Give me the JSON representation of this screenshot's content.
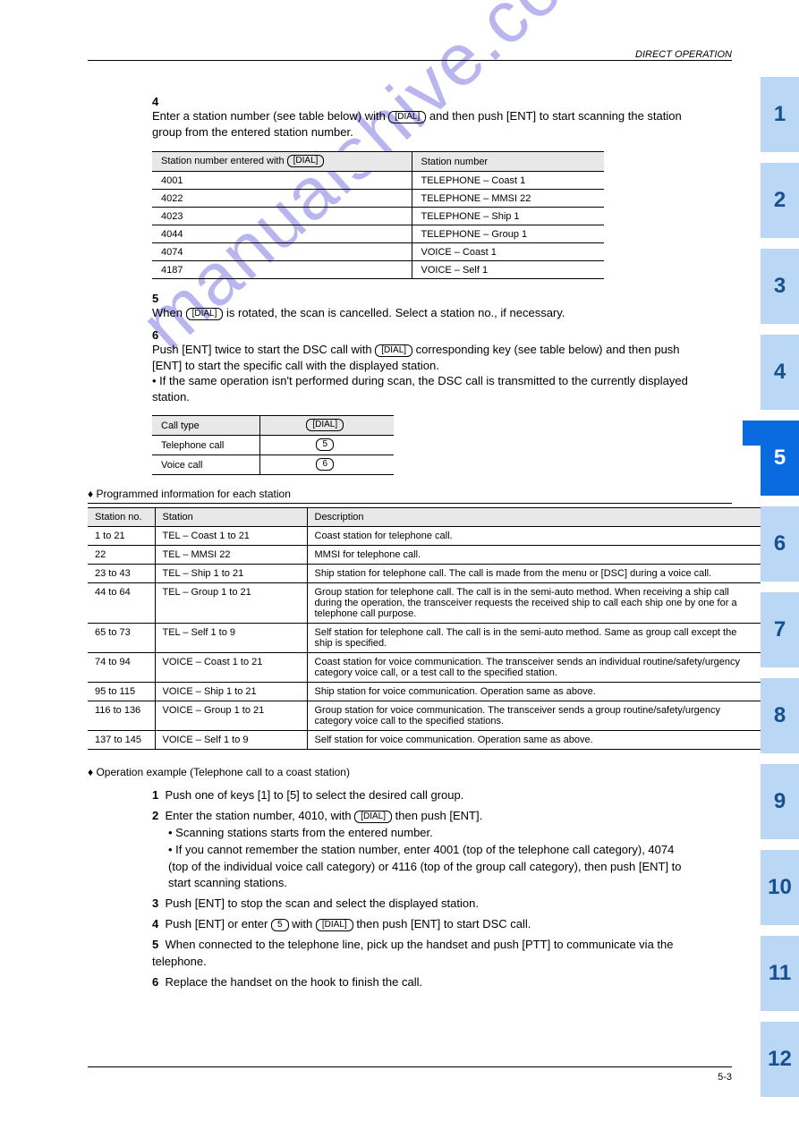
{
  "header": {
    "section_title": "DIRECT OPERATION"
  },
  "watermark": "manualshive.com",
  "steps": {
    "s4": {
      "num": "4",
      "text_prefix": "Enter a station number (see table below) with ",
      "key": "[DIAL]",
      "text_suffix": " and then push [ENT] to start scanning the station group from the entered station number."
    },
    "table1_headers": [
      "Station number entered with ",
      "Station number"
    ],
    "table1_key": "[DIAL]",
    "table1_rows": [
      [
        "4001",
        "TELEPHONE – Coast 1"
      ],
      [
        "4022",
        "TELEPHONE – MMSI 22"
      ],
      [
        "4023",
        "TELEPHONE – Ship 1"
      ],
      [
        "4044",
        "TELEPHONE – Group 1"
      ],
      [
        "4074",
        "VOICE – Coast 1"
      ],
      [
        "4187",
        "VOICE – Self 1"
      ]
    ],
    "s5": {
      "num": "5",
      "text_prefix": "When ",
      "key": "[DIAL]",
      "text_suffix": " is rotated, the scan is cancelled. Select a station no., if necessary."
    },
    "s6": {
      "num": "6",
      "text_prefix": "Push [ENT] twice to start the DSC call with ",
      "key": "[DIAL]",
      "text_mid": " corresponding key (see table below) and then push [ENT] to start the specific call with the displayed station.",
      "text_line2": "• If the same operation isn't performed during scan, the DSC call is transmitted to the currently displayed station."
    },
    "table2_headers": [
      "Call type",
      ""
    ],
    "table2_key": "[DIAL]",
    "table2_rows": [
      [
        "Telephone call",
        "5"
      ],
      [
        "Voice call",
        "6"
      ]
    ]
  },
  "main_table": {
    "heading": "♦ Programmed information for each station",
    "headers": [
      "Station no.",
      "Station",
      "Description"
    ],
    "rows": [
      [
        "1 to 21",
        "TEL – Coast 1 to 21",
        "Coast station for telephone call."
      ],
      [
        "22",
        "TEL – MMSI 22",
        "MMSI for telephone call."
      ],
      [
        "23 to 43",
        "TEL – Ship 1 to 21",
        "Ship station for telephone call. The call is made from the menu or [DSC] during a voice call."
      ],
      [
        "44 to 64",
        "TEL – Group 1 to 21",
        "Group station for telephone call. The call is in the semi-auto method. When receiving a ship call during the operation, the transceiver requests the received ship to call each ship one by one for a telephone call purpose."
      ],
      [
        "65 to 73",
        "TEL – Self 1 to 9",
        "Self station for telephone call. The call is in the semi-auto method. Same as group call except the ship is specified."
      ],
      [
        "74 to 94",
        "VOICE – Coast 1 to 21",
        "Coast station for voice communication. The transceiver sends an individual routine/safety/urgency category voice call, or a test call to the specified station."
      ],
      [
        "95 to 115",
        "VOICE – Ship 1 to 21",
        "Ship station for voice communication. Operation same as above."
      ],
      [
        "116 to 136",
        "VOICE – Group 1 to 21",
        "Group station for voice communication. The transceiver sends a group routine/safety/urgency category voice call to the specified stations."
      ],
      [
        "137 to 145",
        "VOICE – Self 1 to 9",
        "Self station for voice communication. Operation same as above."
      ]
    ]
  },
  "example": {
    "heading": "♦ Operation example (Telephone call to a coast station)",
    "e1_num": "1",
    "e1": "Push one of keys [1] to [5] to select the desired call group.",
    "e2_num": "2",
    "e2_prefix": "Enter the station number, 4010, with ",
    "e2_key": "[DIAL]",
    "e2_suffix": " then push [ENT].",
    "e2_line2": "• Scanning stations starts from the entered number.",
    "e2_line3": "• If you cannot remember the station number, enter 4001 (top of the telephone call category), 4074 (top of the individual voice call category) or 4116 (top of the group call category), then push [ENT] to start scanning stations.",
    "e3_num": "3",
    "e3": "Push [ENT] to stop the scan and select the displayed station.",
    "e4_num": "4",
    "e4_prefix": "Push [ENT] or enter ",
    "e4_key": "[DIAL]",
    "e4_mid": " with ",
    "e4_key2": "5",
    "e4_suffix": " then push [ENT] to start DSC call.",
    "e5_num": "5",
    "e5": "When connected to the telephone line, pick up the handset and push [PTT] to communicate via the telephone.",
    "e6_num": "6",
    "e6": "Replace the handset on the hook to finish the call."
  },
  "footer": {
    "page": "5-3"
  },
  "tabs": [
    "1",
    "2",
    "3",
    "4",
    "5",
    "6",
    "7",
    "8",
    "9",
    "10",
    "11",
    "12"
  ],
  "active_tab_index": 4
}
